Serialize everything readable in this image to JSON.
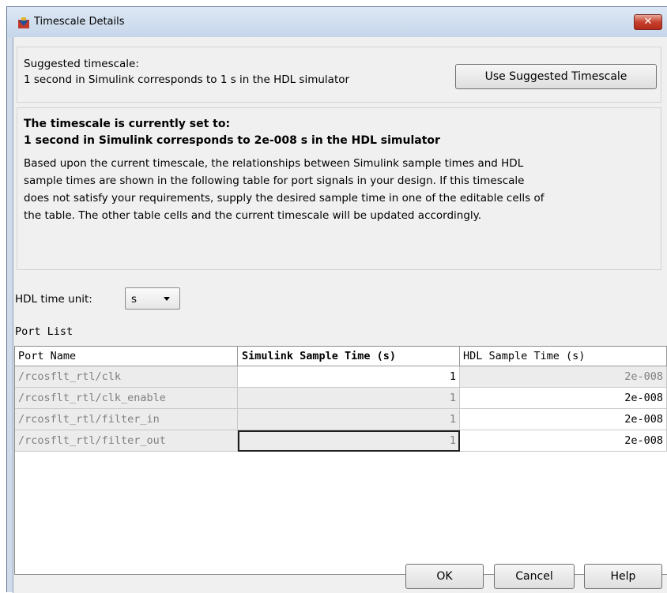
{
  "window": {
    "title": "Timescale Details",
    "close_glyph": "✕"
  },
  "suggested": {
    "label": "Suggested timescale:",
    "text": "1 second in Simulink corresponds to 1 s in the HDL simulator",
    "button_label": "Use Suggested Timescale"
  },
  "current": {
    "title_line1": "The timescale is currently set to:",
    "title_line2": "1 second in Simulink corresponds to 2e-008 s in the HDL simulator",
    "desc_line1": "Based upon the current timescale, the relationships between Simulink sample times and HDL",
    "desc_line2": "sample times are shown in the following table for port signals in your design. If this timescale",
    "desc_line3": "does not satisfy your requirements, supply the desired sample time in one of the editable cells of",
    "desc_line4": "the table. The other table cells and the current timescale will be updated accordingly."
  },
  "hdl_unit": {
    "label": "HDL time unit:",
    "value": "s"
  },
  "port_list": {
    "label": "Port List",
    "headers": [
      "Port Name",
      "Simulink Sample Time (s)",
      "HDL Sample Time (s)"
    ],
    "rows": [
      [
        "/rcosflt_rtl/clk",
        "1",
        "2e-008"
      ],
      [
        "/rcosflt_rtl/clk_enable",
        "1",
        "2e-008"
      ],
      [
        "/rcosflt_rtl/filter_in",
        "1",
        "2e-008"
      ],
      [
        "/rcosflt_rtl/filter_out",
        "1",
        "2e-008"
      ]
    ]
  },
  "buttons": {
    "ok": "OK",
    "cancel": "Cancel",
    "help": "Help"
  },
  "icons": {
    "app": "simulink-app-icon",
    "close": "close-icon",
    "dropdown": "chevron-down-icon"
  }
}
